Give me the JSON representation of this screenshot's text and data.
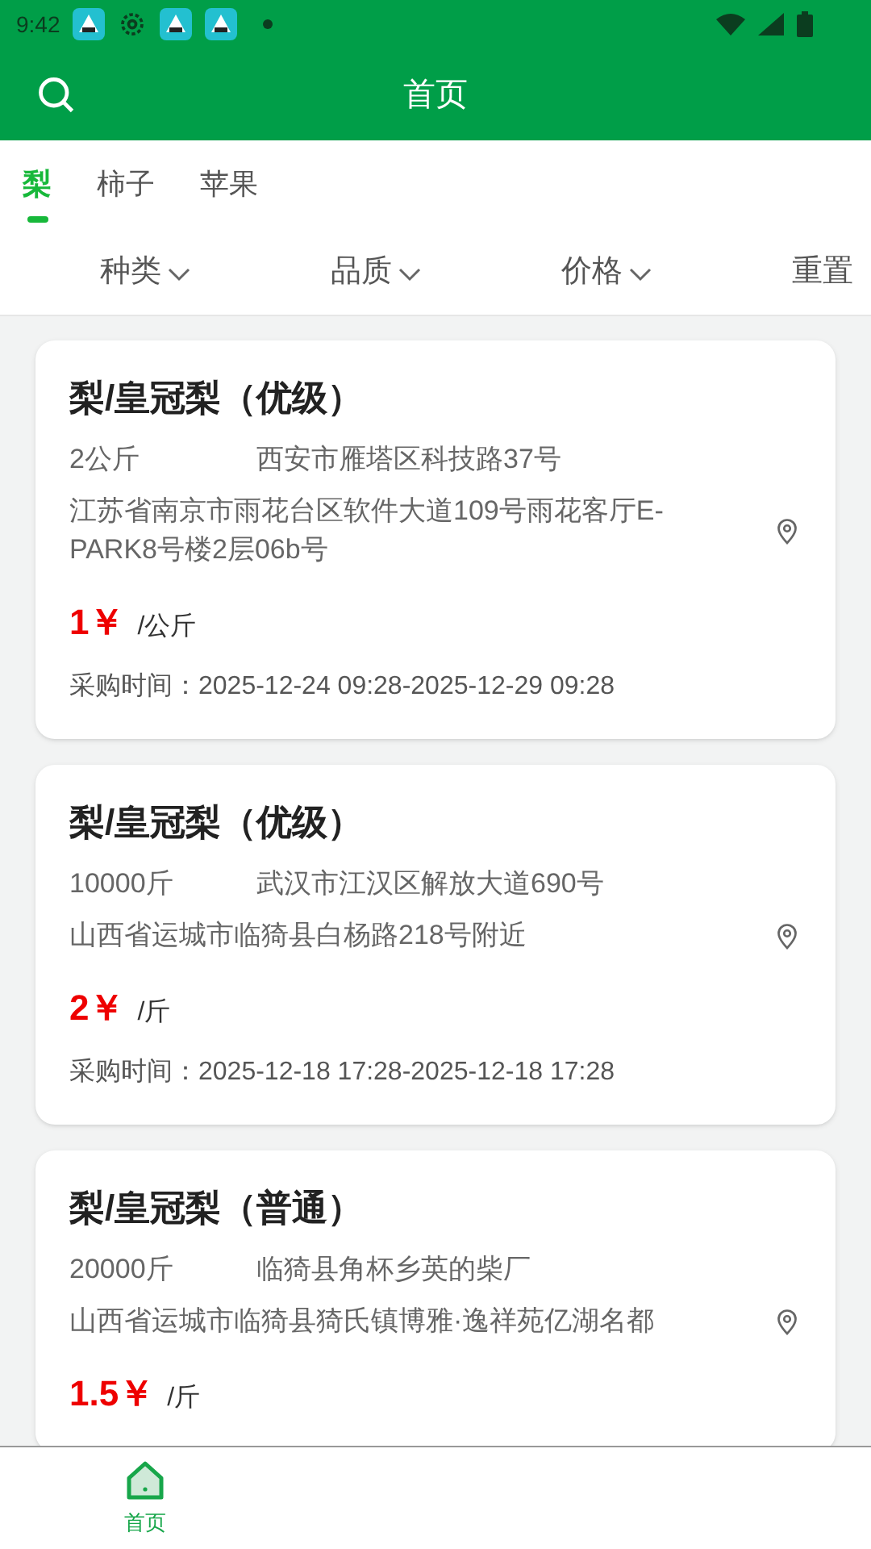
{
  "status_bar": {
    "time": "9:42"
  },
  "header": {
    "title": "首页"
  },
  "tabs": [
    {
      "label": "梨",
      "selected": true
    },
    {
      "label": "柿子",
      "selected": false
    },
    {
      "label": "苹果",
      "selected": false
    }
  ],
  "filters": [
    {
      "label": "种类",
      "kind": "dropdown"
    },
    {
      "label": "品质",
      "kind": "dropdown"
    },
    {
      "label": "价格",
      "kind": "dropdown"
    },
    {
      "label": "重置",
      "kind": "button"
    }
  ],
  "cards": [
    {
      "title": "梨/皇冠梨（优级）",
      "quantity": "2公斤",
      "origin": "西安市雁塔区科技路37号",
      "address": "江苏省南京市雨花台区软件大道109号雨花客厅E-PARK8号楼2层06b号",
      "price": "1￥",
      "unit": "/公斤",
      "time": "采购时间：2025-12-24 09:28-2025-12-29 09:28"
    },
    {
      "title": "梨/皇冠梨（优级）",
      "quantity": "10000斤",
      "origin": "武汉市江汉区解放大道690号",
      "address": "山西省运城市临猗县白杨路218号附近",
      "price": "2￥",
      "unit": "/斤",
      "time": "采购时间：2025-12-18 17:28-2025-12-18 17:28"
    },
    {
      "title": "梨/皇冠梨（普通）",
      "quantity": "20000斤",
      "origin": "临猗县角杯乡英的柴厂",
      "address": "山西省运城市临猗县猗氏镇博雅·逸祥苑亿湖名都",
      "price": "1.5￥",
      "unit": "/斤"
    }
  ],
  "bottom_nav": [
    {
      "label": "首页",
      "selected": true
    }
  ]
}
